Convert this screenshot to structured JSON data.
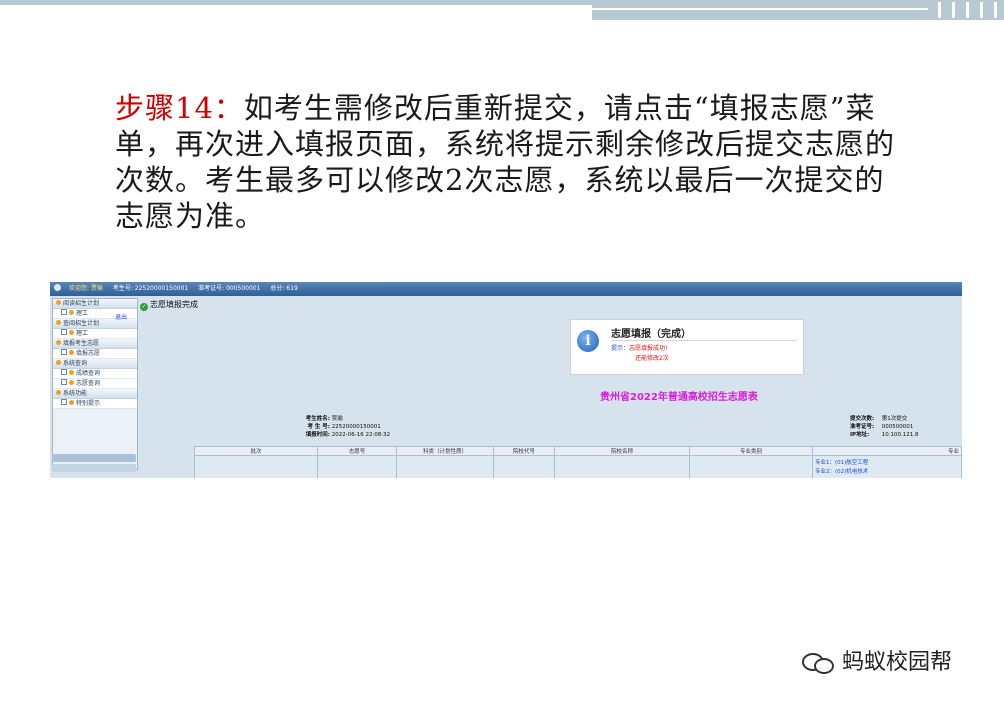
{
  "slide": {
    "step_label": "步骤14：",
    "body": "如考生需修改后重新提交，请点击“填报志愿”菜单，再次进入填报页面，系统将提示剩余修改后提交志愿的次数。考生最多可以修改2次志愿，系统以最后一次提交的志愿为准。"
  },
  "screenshot": {
    "header": {
      "welcome": "欢迎您: 贾瑜",
      "exam_no": "考生号: 22520000150001",
      "ticket_no": "准考证号: 000500001",
      "score": "总分: 619"
    },
    "sidebar": {
      "logout_link": "退出",
      "groups": [
        {
          "label": "阅读招生计划",
          "items": [
            "理工"
          ]
        },
        {
          "label": "查阅招生计划",
          "items": [
            "理工"
          ]
        },
        {
          "label": "填报考生志愿",
          "items": [
            "填报志愿"
          ]
        },
        {
          "label": "系统查询",
          "items": [
            "成绩查询",
            "志愿查询"
          ]
        },
        {
          "label": "系统功能",
          "items": [
            "特别提示"
          ]
        }
      ]
    },
    "main_title": "志愿填报完成",
    "dialog": {
      "title": "志愿填报（完成）",
      "hint_label": "提示：",
      "message": "志愿填报成功!",
      "remaining": "还能修改2次"
    },
    "sheet_title": "贵州省2022年普通高校招生志愿表",
    "info_left": [
      {
        "k": "考生姓名:",
        "v": "贾瑜"
      },
      {
        "k": "考 生 号:",
        "v": "22520000150001"
      },
      {
        "k": "填报时间:",
        "v": "2022-06-16 22:08:32"
      }
    ],
    "info_right": [
      {
        "k": "提交次数:",
        "v": "第1次提交"
      },
      {
        "k": "准考证号:",
        "v": "000500001"
      },
      {
        "k": "IP地址:",
        "v": "10.100.121.8"
      }
    ],
    "table": {
      "headers": [
        "批次",
        "志愿号",
        "科类（计划性质）",
        "院校代号",
        "院校名称",
        "专业类别",
        "专业"
      ],
      "majors": [
        "专业1：(01)航空工程",
        "专业2：(02)机电技术"
      ]
    }
  },
  "watermark": "蚂蚁校园帮"
}
